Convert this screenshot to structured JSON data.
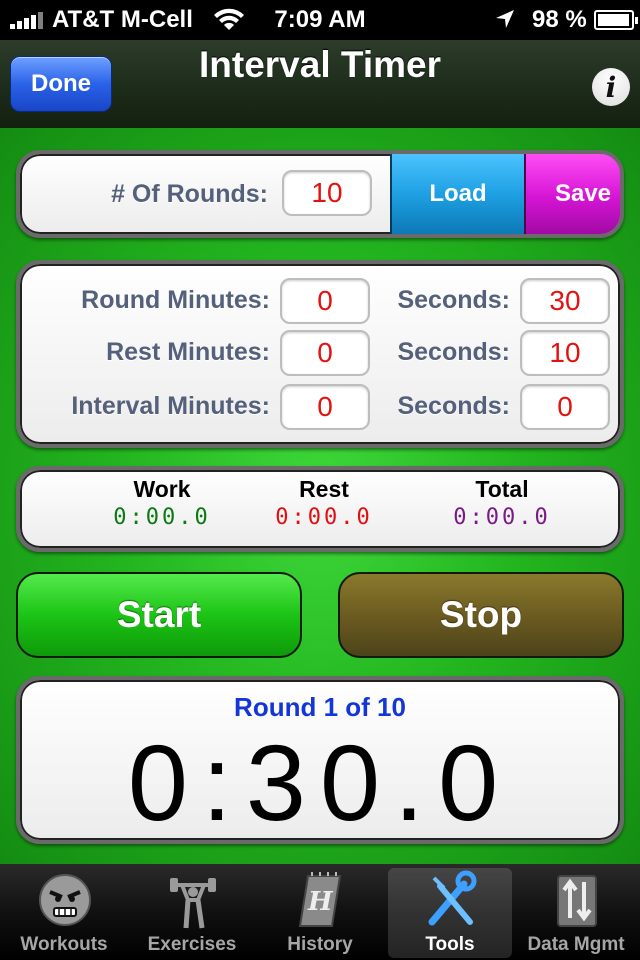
{
  "status_bar": {
    "carrier": "AT&T M-Cell",
    "time": "7:09 AM",
    "battery": "98 %",
    "battery_level": 0.98,
    "icons": [
      "signal-bars-icon",
      "wifi-icon",
      "location-arrow-icon",
      "battery-icon"
    ]
  },
  "nav": {
    "title": "Interval Timer",
    "done_label": "Done",
    "info_label": "i"
  },
  "rounds": {
    "label": "# Of Rounds:",
    "value": "10",
    "load_label": "Load",
    "save_label": "Save"
  },
  "times": {
    "round_minutes_label": "Round Minutes:",
    "round_minutes": "0",
    "round_seconds_label": "Seconds:",
    "round_seconds": "30",
    "rest_minutes_label": "Rest Minutes:",
    "rest_minutes": "0",
    "rest_seconds_label": "Seconds:",
    "rest_seconds": "10",
    "interval_minutes_label": "Interval Minutes:",
    "interval_minutes": "0",
    "interval_seconds_label": "Seconds:",
    "interval_seconds": "0"
  },
  "totals": {
    "work_label": "Work",
    "work_value": "0:00.0",
    "rest_label": "Rest",
    "rest_value": "0:00.0",
    "total_label": "Total",
    "total_value": "0:00.0",
    "colors": {
      "work": "#0a7a12",
      "rest": "#e01010",
      "total": "#7a1a86"
    }
  },
  "controls": {
    "start_label": "Start",
    "stop_label": "Stop"
  },
  "display": {
    "round_text": "Round 1 of 10",
    "time": "0:30.0"
  },
  "tabs": [
    {
      "label": "Workouts",
      "icon": "angry-face-icon",
      "selected": false
    },
    {
      "label": "Exercises",
      "icon": "weightlifter-icon",
      "selected": false
    },
    {
      "label": "History",
      "icon": "notepad-icon",
      "selected": false
    },
    {
      "label": "Tools",
      "icon": "wrench-screwdriver-icon",
      "selected": true
    },
    {
      "label": "Data Mgmt",
      "icon": "data-transfer-icon",
      "selected": false
    }
  ]
}
